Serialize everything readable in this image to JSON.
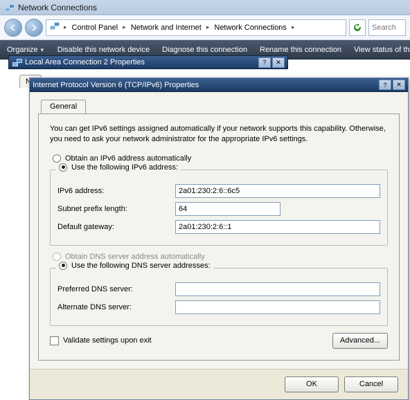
{
  "explorer": {
    "title": "Network Connections",
    "crumbs": [
      "Control Panel",
      "Network and Internet",
      "Network Connections"
    ],
    "search_placeholder": "Search",
    "commands": {
      "organize": "Organize",
      "disable": "Disable this network device",
      "diagnose": "Diagnose this connection",
      "rename": "Rename this connection",
      "viewstatus": "View status of this"
    }
  },
  "lac_props": {
    "title": "Local Area Connection 2 Properties",
    "tab": "Ne"
  },
  "ipv6": {
    "title": "Internet Protocol Version 6 (TCP/IPv6) Properties",
    "tab_general": "General",
    "description": "You can get IPv6 settings assigned automatically if your network supports this capability. Otherwise, you need to ask your network administrator for the appropriate IPv6 settings.",
    "radio_auto_addr": "Obtain an IPv6 address automatically",
    "radio_manual_addr": "Use the following IPv6 address:",
    "label_ipv6_address": "IPv6 address:",
    "value_ipv6_address": "2a01:230:2:6::6c5",
    "label_prefix": "Subnet prefix length:",
    "value_prefix": "64",
    "label_gateway": "Default gateway:",
    "value_gateway": "2a01:230:2:6::1",
    "radio_auto_dns": "Obtain DNS server address automatically",
    "radio_manual_dns": "Use the following DNS server addresses:",
    "label_pref_dns": "Preferred DNS server:",
    "value_pref_dns": "",
    "label_alt_dns": "Alternate DNS server:",
    "value_alt_dns": "",
    "validate": "Validate settings upon exit",
    "advanced": "Advanced...",
    "ok": "OK",
    "cancel": "Cancel"
  }
}
